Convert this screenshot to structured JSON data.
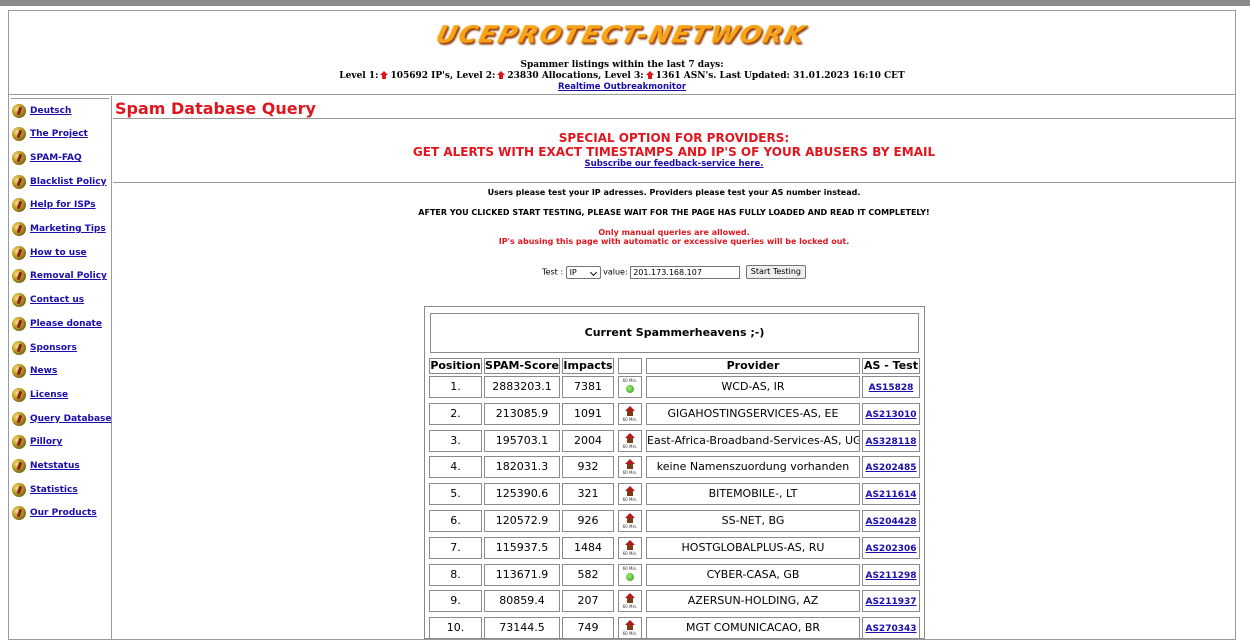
{
  "header": {
    "logo": "UCEPROTECT-NETWORK",
    "line1": "Spammer listings within the last 7 days:",
    "level1_prefix": "Level 1:",
    "level1_text": "105692 IP's, Level 2:",
    "level2_text": "23830 Allocations, Level 3:",
    "level3_text": "1361 ASN's. Last Updated: 31.01.2023 16:10 CET",
    "realtime_link": "Realtime Outbreakmonitor"
  },
  "sidebar": {
    "items": [
      {
        "label": "Deutsch"
      },
      {
        "label": "The Project"
      },
      {
        "label": "SPAM-FAQ"
      },
      {
        "label": "Blacklist Policy"
      },
      {
        "label": "Help for ISPs"
      },
      {
        "label": "Marketing Tips"
      },
      {
        "label": "How to use"
      },
      {
        "label": "Removal Policy"
      },
      {
        "label": "Contact us"
      },
      {
        "label": "Please donate"
      },
      {
        "label": "Sponsors"
      },
      {
        "label": "News"
      },
      {
        "label": "License"
      },
      {
        "label": "Query Database"
      },
      {
        "label": "Pillory"
      },
      {
        "label": "Netstatus"
      },
      {
        "label": "Statistics"
      },
      {
        "label": "Our Products"
      }
    ]
  },
  "main": {
    "title": "Spam Database Query",
    "special_line1": "SPECIAL OPTION FOR PROVIDERS:",
    "special_line2": "GET ALERTS WITH EXACT TIMESTAMPS AND IP'S OF YOUR ABUSERS BY EMAIL",
    "special_link": "Subscribe our feedback-service here.",
    "note1": "Users please test your IP adresses. Providers please test your AS number instead.",
    "note2": "AFTER YOU CLICKED START TESTING, PLEASE WAIT FOR THE PAGE HAS FULLY LOADED AND READ IT COMPLETELY!",
    "warn1": "Only manual queries are allowed.",
    "warn2": "IP's abusing this page with automatic or excessive queries will be locked out.",
    "form": {
      "test_label": "Test :",
      "test_value": "IP",
      "value_label": "value:",
      "value": "201.173.168.107",
      "button": "Start Testing"
    }
  },
  "table": {
    "caption": "Current Spammerheavens ;-)",
    "headers": [
      "Position",
      "SPAM-Score",
      "Impacts",
      "",
      "Provider",
      "AS - Test"
    ],
    "icon_label": "60 Min.",
    "rows": [
      {
        "pos": "1.",
        "score": "2883203.1",
        "impacts": "7381",
        "icon": "green-dot-icon",
        "provider": "WCD-AS, IR",
        "as": "AS15828"
      },
      {
        "pos": "2.",
        "score": "213085.9",
        "impacts": "1091",
        "icon": "house-icon",
        "provider": "GIGAHOSTINGSERVICES-AS, EE",
        "as": "AS213010"
      },
      {
        "pos": "3.",
        "score": "195703.1",
        "impacts": "2004",
        "icon": "house-icon",
        "provider": "East-Africa-Broadband-Services-AS, UG",
        "as": "AS328118"
      },
      {
        "pos": "4.",
        "score": "182031.3",
        "impacts": "932",
        "icon": "house-icon",
        "provider": "keine Namenszuordung vorhanden",
        "as": "AS202485"
      },
      {
        "pos": "5.",
        "score": "125390.6",
        "impacts": "321",
        "icon": "house-icon",
        "provider": "BITEMOBILE-, LT",
        "as": "AS211614"
      },
      {
        "pos": "6.",
        "score": "120572.9",
        "impacts": "926",
        "icon": "house-icon",
        "provider": "SS-NET, BG",
        "as": "AS204428"
      },
      {
        "pos": "7.",
        "score": "115937.5",
        "impacts": "1484",
        "icon": "house-icon",
        "provider": "HOSTGLOBALPLUS-AS, RU",
        "as": "AS202306"
      },
      {
        "pos": "8.",
        "score": "113671.9",
        "impacts": "582",
        "icon": "green-dot-icon",
        "provider": "CYBER-CASA, GB",
        "as": "AS211298"
      },
      {
        "pos": "9.",
        "score": "80859.4",
        "impacts": "207",
        "icon": "house-icon",
        "provider": "AZERSUN-HOLDING, AZ",
        "as": "AS211937"
      },
      {
        "pos": "10.",
        "score": "73144.5",
        "impacts": "749",
        "icon": "house-icon",
        "provider": "MGT COMUNICACAO, BR",
        "as": "AS270343"
      }
    ]
  }
}
